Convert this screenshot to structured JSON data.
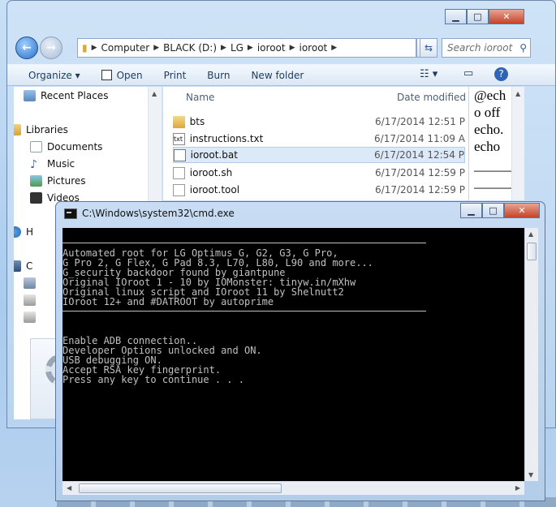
{
  "explorer": {
    "address": [
      "Computer",
      "BLACK (D:)",
      "LG",
      "ioroot",
      "ioroot"
    ],
    "search_placeholder": "Search ioroot",
    "toolbar": {
      "organize": "Organize ▾",
      "open": "Open",
      "print": "Print",
      "burn": "Burn",
      "new_folder": "New folder"
    },
    "nav": {
      "recent_places": "Recent Places",
      "libraries": "Libraries",
      "documents": "Documents",
      "music": "Music",
      "pictures": "Pictures",
      "videos": "Videos",
      "homegroup": "H",
      "computer": "C"
    },
    "columns": {
      "name": "Name",
      "date_modified": "Date modified"
    },
    "files": [
      {
        "name": "bts",
        "date": "6/17/2014 12:51 P",
        "icon": "folder-icon"
      },
      {
        "name": "instructions.txt",
        "date": "6/17/2014 11:09 A",
        "icon": "text-file-icon"
      },
      {
        "name": "ioroot.bat",
        "date": "6/17/2014 12:54 P",
        "icon": "batch-file-icon"
      },
      {
        "name": "ioroot.sh",
        "date": "6/17/2014 12:59 P",
        "icon": "file-icon"
      },
      {
        "name": "ioroot.tool",
        "date": "6/17/2014 12:59 P",
        "icon": "file-icon"
      }
    ],
    "preview_lines": [
      "@ech",
      "o off",
      "echo.",
      "echo",
      "———",
      "———"
    ]
  },
  "cmd": {
    "title": "C:\\Windows\\system32\\cmd.exe",
    "banner": [
      "Automated root for LG Optimus G, G2, G3, G Pro,",
      "G Pro 2, G Flex, G Pad 8.3, L70, L80, L90 and more...",
      "G_security backdoor found by giantpune",
      "Original IOroot 1 - 10 by IOMonster: tinyw.in/mXhw",
      "Original linux script and IOroot 11 by Shelnutt2",
      "IOroot 12+ and #DATROOT by autoprime"
    ],
    "status": [
      "Enable ADB connection..",
      "Developer Options unlocked and ON.",
      "USB debugging ON.",
      "Accept RSA key fingerprint.",
      "Press any key to continue . . ."
    ]
  }
}
